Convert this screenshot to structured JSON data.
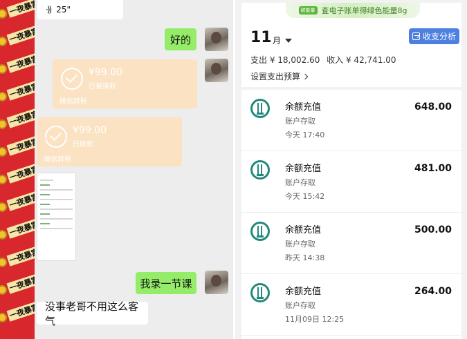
{
  "left_strip": {
    "sticker_text": "一夜暴富"
  },
  "chat": {
    "voice": {
      "icon": "voice-wave-icon",
      "duration": "25\""
    },
    "messages": [
      {
        "side": "right",
        "type": "text",
        "text": "好的"
      },
      {
        "side": "right",
        "type": "transfer",
        "amount": "¥99.00",
        "status": "已被接收",
        "footer": "微信转账"
      },
      {
        "side": "left",
        "type": "transfer",
        "amount": "¥99.00",
        "status": "已收款",
        "footer": "微信转账"
      },
      {
        "side": "left",
        "type": "image"
      },
      {
        "side": "right",
        "type": "text",
        "text": "我录一节课"
      },
      {
        "side": "left",
        "type": "text",
        "text": "没事老哥不用这么客气"
      }
    ]
  },
  "bill": {
    "banner": {
      "badge": "碳能量",
      "text": "查电子账单得绿色能量8g"
    },
    "month": "11",
    "month_unit": "月",
    "analyze_button": "收支分析",
    "expense": "支出 ¥ 18,002.60",
    "income": "收入 ¥ 42,741.00",
    "budget_link": "设置支出预算",
    "transactions": [
      {
        "title": "余额充值",
        "subtitle": "账户存取",
        "time": "今天 17:40",
        "amount": "648.00"
      },
      {
        "title": "余额充值",
        "subtitle": "账户存取",
        "time": "今天 15:42",
        "amount": "481.00"
      },
      {
        "title": "余额充值",
        "subtitle": "账户存取",
        "time": "昨天 14:38",
        "amount": "500.00"
      },
      {
        "title": "余额充值",
        "subtitle": "账户存取",
        "time": "11月09日 12:25",
        "amount": "264.00"
      }
    ]
  },
  "colors": {
    "wechat_green": "#95ec69",
    "transfer_orange": "#fbe2c2",
    "bank_green": "#1f8a7a",
    "accent_blue": "#4e7fe0"
  }
}
